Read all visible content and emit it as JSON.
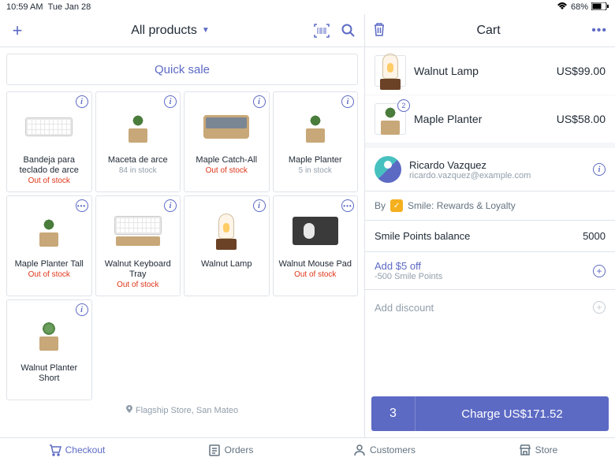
{
  "status": {
    "time": "10:59 AM",
    "date": "Tue Jan 28",
    "battery": "68%"
  },
  "header": {
    "title": "All products",
    "cart_title": "Cart",
    "quick_sale": "Quick sale"
  },
  "products": [
    {
      "name": "Bandeja para teclado de arce",
      "stock": "Out of stock",
      "out": true,
      "icon": "i",
      "img": "keyboard"
    },
    {
      "name": "Maceta de arce",
      "stock": "84 in stock",
      "out": false,
      "icon": "i",
      "img": "planter"
    },
    {
      "name": "Maple Catch-All",
      "stock": "Out of stock",
      "out": true,
      "icon": "i",
      "img": "tray"
    },
    {
      "name": "Maple Planter",
      "stock": "5 in stock",
      "out": false,
      "icon": "i",
      "img": "planter"
    },
    {
      "name": "Maple Planter Tall",
      "stock": "Out of stock",
      "out": true,
      "icon": "dots",
      "img": "planter"
    },
    {
      "name": "Walnut Keyboard Tray",
      "stock": "Out of stock",
      "out": true,
      "icon": "i",
      "img": "kbtray"
    },
    {
      "name": "Walnut Lamp",
      "stock": "",
      "out": false,
      "icon": "i",
      "img": "lamp"
    },
    {
      "name": "Walnut Mouse Pad",
      "stock": "Out of stock",
      "out": true,
      "icon": "dots",
      "img": "mousepad"
    },
    {
      "name": "Walnut Planter Short",
      "stock": "",
      "out": false,
      "icon": "i",
      "img": "succ"
    }
  ],
  "location": "Flagship Store, San Mateo",
  "cart_items": [
    {
      "name": "Walnut Lamp",
      "price": "US$99.00",
      "qty": null,
      "img": "lamp"
    },
    {
      "name": "Maple Planter",
      "price": "US$58.00",
      "qty": "2",
      "img": "planter"
    }
  ],
  "customer": {
    "name": "Ricardo Vazquez",
    "email": "ricardo.vazquez@example.com"
  },
  "loyalty": {
    "by": "By",
    "app": "Smile: Rewards & Loyalty",
    "balance_label": "Smile Points balance",
    "balance": "5000",
    "reward_title": "Add $5 off",
    "reward_sub": "-500 Smile Points"
  },
  "discount": "Add discount",
  "charge": {
    "qty": "3",
    "label": "Charge US$171.52"
  },
  "nav": [
    {
      "l": "Checkout"
    },
    {
      "l": "Orders"
    },
    {
      "l": "Customers"
    },
    {
      "l": "Store"
    }
  ]
}
